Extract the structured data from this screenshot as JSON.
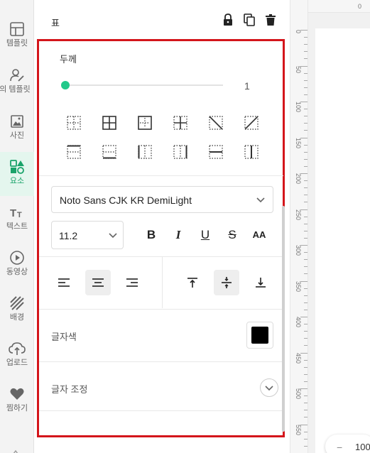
{
  "rail": {
    "items": [
      {
        "label": "템플릿",
        "icon": "layout-template-icon"
      },
      {
        "label": "의 템플릿",
        "icon": "person-edit-icon"
      },
      {
        "label": "사진",
        "icon": "photo-icon"
      },
      {
        "label": "요소",
        "icon": "elements-icon"
      },
      {
        "label": "텍스트",
        "icon": "text-icon"
      },
      {
        "label": "동영상",
        "icon": "play-icon"
      },
      {
        "label": "배경",
        "icon": "background-hatch-icon"
      },
      {
        "label": "업로드",
        "icon": "upload-cloud-icon"
      },
      {
        "label": "찜하기",
        "icon": "heart-icon"
      }
    ],
    "active_index": 3
  },
  "panel": {
    "title": "표",
    "thickness_label": "두께",
    "thickness_value": "1",
    "thickness_level": 0,
    "font_family": "Noto Sans CJK KR DemiLight",
    "font_size": "11.2",
    "format_buttons": {
      "bold": "B",
      "italic": "I",
      "underline": "U",
      "strike": "S",
      "case": "AA"
    },
    "text_color_label": "글자색",
    "text_color": "#000000",
    "text_adjust_label": "글자 조정"
  },
  "ruler": {
    "labels": [
      "0",
      "50",
      "100",
      "150",
      "200",
      "250",
      "300",
      "350",
      "400",
      "450",
      "500",
      "550"
    ],
    "top_label": "0"
  },
  "zoom": {
    "minus": "−",
    "value": "100"
  },
  "colors": {
    "accent": "#22c98a",
    "frame": "#d4151b",
    "active_rail_bg": "#e4f6ee"
  }
}
